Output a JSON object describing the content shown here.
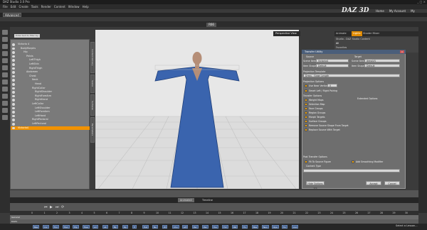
{
  "window": {
    "title": "DAZ Studio 3.0 Pro",
    "controls": "_ □ ×"
  },
  "menu": [
    "File",
    "Edit",
    "Create",
    "Tools",
    "Render",
    "Content",
    "Window",
    "Help"
  ],
  "branding": {
    "logo": "DAZ 3D",
    "links": [
      "Home",
      "My Account",
      "My Gallery"
    ]
  },
  "layout": {
    "name": "Advanced"
  },
  "viewport": {
    "tab": "R66",
    "header": "Perspective View"
  },
  "scene": {
    "search_placeholder": "Enter text to filter by...",
    "tabs": [
      "Content Library",
      "Scene",
      "Surfaces",
      "Parameters"
    ],
    "tree": [
      {
        "label": "Victoria 4",
        "indent": 0
      },
      {
        "label": "BodyMorphs",
        "indent": 1
      },
      {
        "label": "Hip",
        "indent": 2
      },
      {
        "label": "Pelvis",
        "indent": 3
      },
      {
        "label": "LeftThigh",
        "indent": 4
      },
      {
        "label": "LeftShin",
        "indent": 4
      },
      {
        "label": "RightThigh",
        "indent": 4
      },
      {
        "label": "Abdomen",
        "indent": 3
      },
      {
        "label": "Chest",
        "indent": 4
      },
      {
        "label": "Neck",
        "indent": 5
      },
      {
        "label": "Head",
        "indent": 6
      },
      {
        "label": "RightCollar",
        "indent": 5
      },
      {
        "label": "RightShoulder",
        "indent": 6
      },
      {
        "label": "RightForeArm",
        "indent": 6
      },
      {
        "label": "RightHand",
        "indent": 6
      },
      {
        "label": "LeftCollar",
        "indent": 5
      },
      {
        "label": "LeftShoulder",
        "indent": 6
      },
      {
        "label": "LeftForeArm",
        "indent": 6
      },
      {
        "label": "LeftHand",
        "indent": 6
      },
      {
        "label": "RightPectoral",
        "indent": 5
      },
      {
        "label": "LeftPectoral",
        "indent": 5
      },
      {
        "label": "Victoria4",
        "indent": 0,
        "selected": true
      }
    ]
  },
  "right_panel": {
    "tabs": [
      "Animate",
      "Lights",
      "Shader Mixer"
    ],
    "info_lines": [
      "Studio - DAZ Studio Content",
      "All",
      "Favorites"
    ]
  },
  "dialog": {
    "title": "Transfer Utility",
    "source_label": "Source",
    "target_label": "Target",
    "scene_item_label": "Scene Item:",
    "source_item": "Victoria4",
    "target_item": "dressV4",
    "item_shape_label": "Item Shape:",
    "source_shape": "Default",
    "target_shape": "Default",
    "template_label": "Projection Template",
    "template_value": "Dress - Gown Length",
    "projection_options_label": "Projection Options",
    "weight_label": "Use Near Vertices",
    "weight_value": "0",
    "smart_rigid": "Smart Left / Right Pairing",
    "transfer_options_label": "Transfer Options",
    "extended_label": "Extended Options",
    "options": [
      "Weight Maps",
      "Selection Map",
      "Face Groups",
      "Region Groups",
      "Morph Targets",
      "Surface Groups",
      "Remove Source Shape From Target",
      "Replace Source With Target"
    ],
    "post_label": "Post Transfer Options",
    "post_fit": "Fit To Source Figure",
    "post_smooth": "Add Smoothing Modifier",
    "content_type_label": "Content Type",
    "hide_button": "Hide Options <<",
    "accept_button": "Accept",
    "cancel_button": "Cancel"
  },
  "timeline": {
    "tabs": [
      "Animate2",
      "Timeline"
    ],
    "frames": [
      "0",
      "1",
      "2",
      "3",
      "4",
      "5",
      "6",
      "7",
      "8",
      "9",
      "10",
      "11",
      "12",
      "13",
      "14",
      "15",
      "16",
      "17",
      "18",
      "19",
      "20",
      "21",
      "22",
      "23",
      "24",
      "25",
      "26",
      "27",
      "28",
      "29",
      "30"
    ],
    "rows": [
      "General",
      "DAZ1",
      "Misc"
    ]
  },
  "bottom": {
    "buttons": [
      "Bas",
      "Cor",
      "Foo",
      "Han",
      "Hip",
      "Hea",
      "Ad",
      "Ab",
      "Bp",
      "Rp",
      "Tr",
      "Hat",
      "Ne",
      "Wi",
      "Chu",
      "Lift",
      "Pec",
      "Pen",
      "Toe",
      "Tim",
      "Pat",
      "Tru",
      "Bas",
      "Neu",
      "Ope",
      "Tur",
      "Ano"
    ],
    "select": "Select a Lesson..."
  }
}
